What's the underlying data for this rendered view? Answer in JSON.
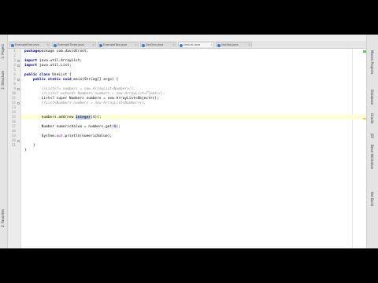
{
  "tabs": [
    {
      "label": "ExampleOne.java",
      "active": false
    },
    {
      "label": "ExampleThree.java",
      "active": false
    },
    {
      "label": "ExampleTwo.java",
      "active": false
    },
    {
      "label": "UseOne.java",
      "active": false
    },
    {
      "label": "UseList.java",
      "active": true
    },
    {
      "label": "UseTwo.java",
      "active": false
    }
  ],
  "left_panels": {
    "project": "1: Project",
    "structure": "2: Structure",
    "favorites": "2: Favorites"
  },
  "right_panels": {
    "maven": "Maven Projects",
    "database": "Database",
    "gradle": "Gradle",
    "jsf": "JSF",
    "bean_validation": "Bean Validation",
    "ant_build": "Ant Build"
  },
  "line_numbers": [
    "1",
    "2",
    "3",
    "4",
    "5",
    "6",
    "7",
    "8",
    "9",
    "10",
    "11",
    "12",
    "13",
    "14",
    "15",
    "16",
    "17",
    "18",
    "19",
    "20",
    "21"
  ],
  "code": {
    "l1": "package com.davidtront;",
    "l3a": "import",
    "l3b": " java.util.ArrayList;",
    "l4a": "import",
    "l4b": " java.util.List;",
    "l6a": "public class",
    "l6b": " UseList {",
    "l7a": "    public static void",
    "l7b": " main(String[] args) {",
    "l9": "        //List<?> numbers = new ArrayList<Number>();",
    "l10": "        //List<? extends Number> numbers = new ArrayList<Float>();",
    "l11": "        List<? super Number> numbers = new ArrayList<Object>();",
    "l12": "        //List<Number> numbers = new ArrayList<Number>();",
    "l14a": "        numbers.add(new ",
    "l14b": "Integer",
    "l14c": "(",
    "l14d": "4",
    "l14e": "));",
    "l16a": "        Number numericValue = numbers.get(",
    "l16b": "0",
    "l16c": ");",
    "l18a": "        System.",
    "l18b": "out",
    "l18c": ".println(numericValue);",
    "l20": "    }",
    "l21": "}"
  },
  "colors": {
    "keyword": "#000080",
    "comment": "#8c8c8c",
    "number": "#0000ff",
    "selection": "#b8c7e8",
    "current_line": "#ffffd7"
  }
}
